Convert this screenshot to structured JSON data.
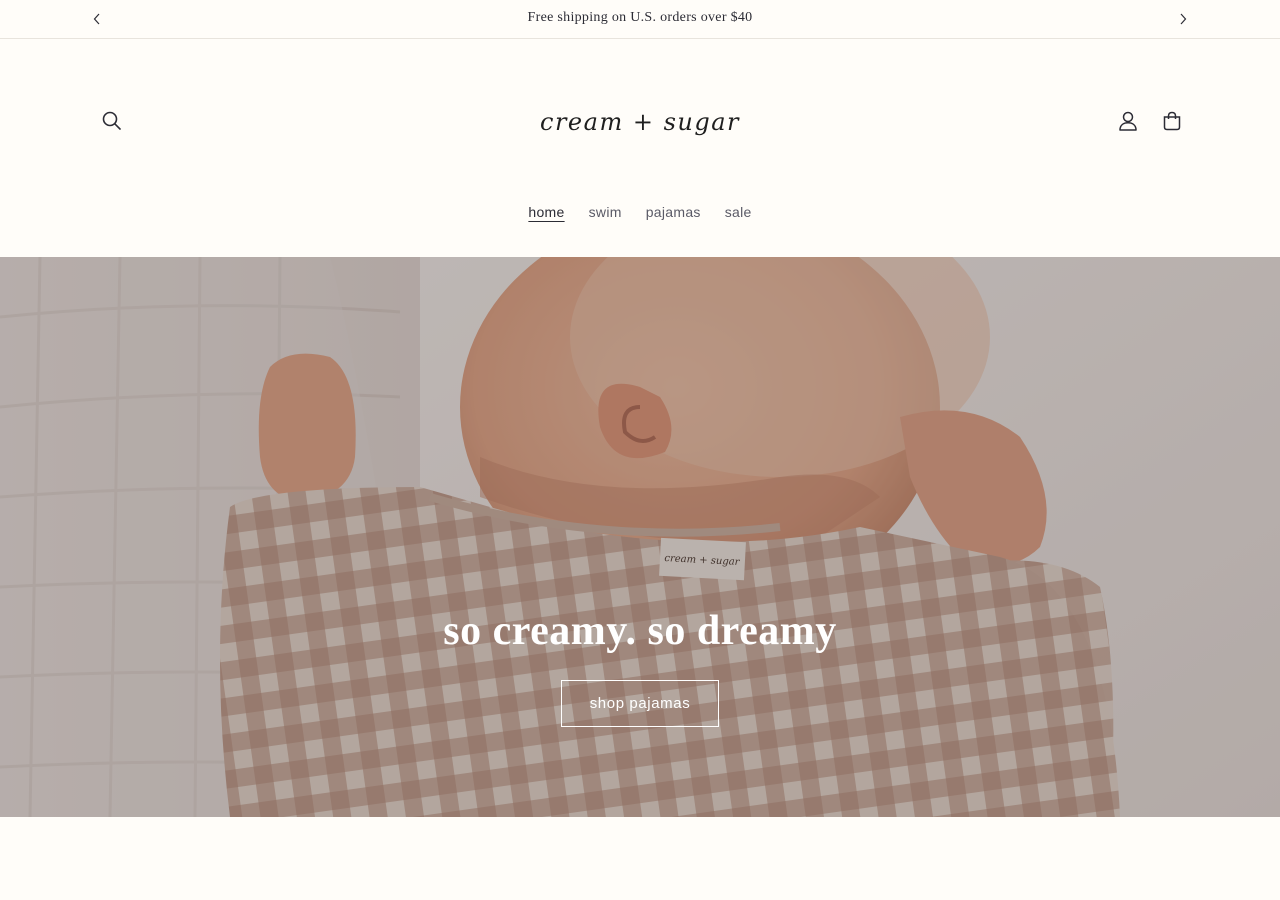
{
  "announcement": {
    "text": "Free shipping on U.S. orders over $40"
  },
  "header": {
    "logo_text": "cream + sugar",
    "search_icon": "search-icon",
    "account_icon": "account-icon",
    "cart_icon": "cart-icon"
  },
  "nav": {
    "items": [
      {
        "label": "home",
        "active": true
      },
      {
        "label": "swim",
        "active": false
      },
      {
        "label": "pajamas",
        "active": false
      },
      {
        "label": "sale",
        "active": false
      }
    ]
  },
  "hero": {
    "heading": "so creamy. so dreamy",
    "button_label": "shop pajamas",
    "tag_text": "cream + sugar"
  },
  "colors": {
    "background": "#fffdf9",
    "text": "#2c2c35",
    "hero_text": "#ffffff"
  }
}
